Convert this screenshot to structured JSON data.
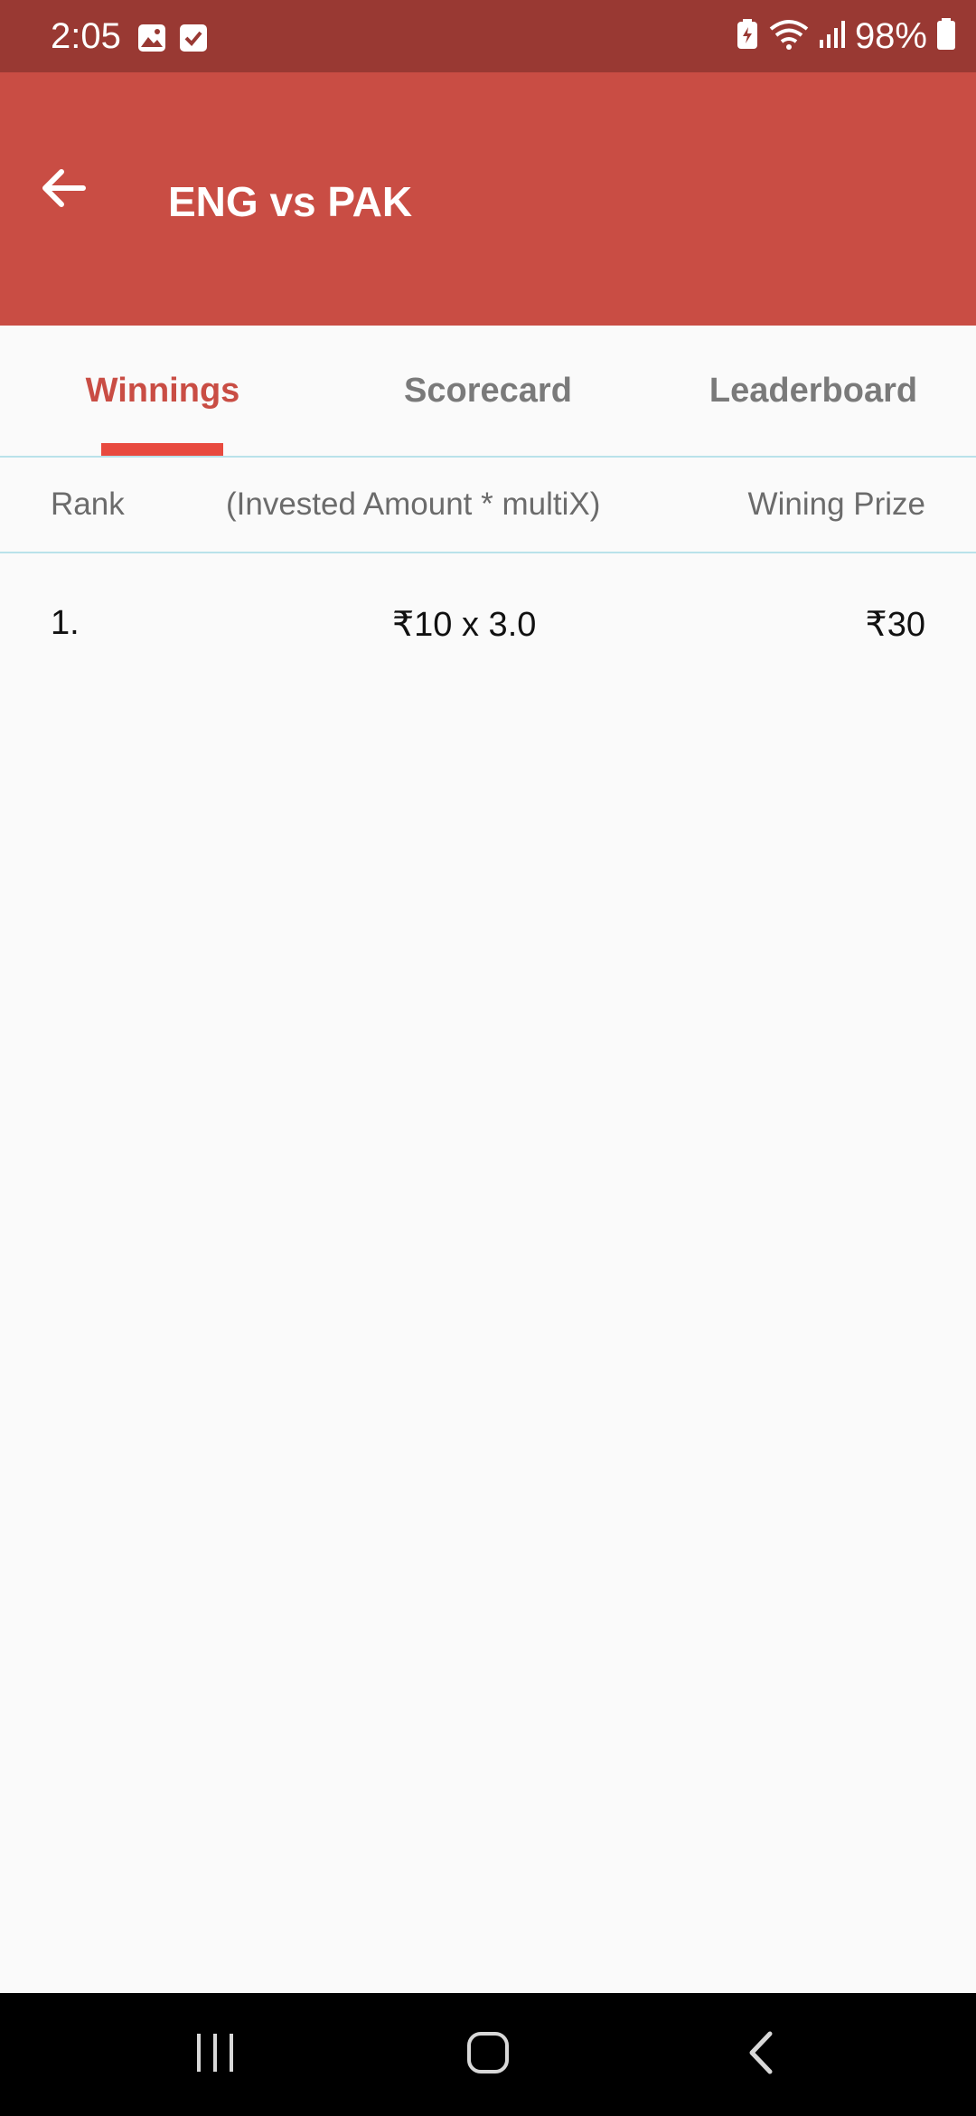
{
  "status_bar": {
    "time": "2:05",
    "battery": "98%",
    "left_icons": [
      "gallery-icon",
      "checkbox-icon"
    ],
    "right_icons": [
      "battery-saver-icon",
      "wifi-icon",
      "signal-icon",
      "battery-icon"
    ]
  },
  "app_bar": {
    "title": "ENG vs PAK",
    "back_icon": "arrow-left-icon",
    "color": "#c94d44"
  },
  "tabs": [
    {
      "label": "Winnings",
      "active": true
    },
    {
      "label": "Scorecard",
      "active": false
    },
    {
      "label": "Leaderboard",
      "active": false
    }
  ],
  "table": {
    "headers": {
      "rank": "Rank",
      "invested": "(Invested Amount * multiX)",
      "prize": "Wining Prize"
    },
    "rows": [
      {
        "rank": "1.",
        "invested": "₹10 x 3.0",
        "prize": "₹30"
      }
    ]
  },
  "nav_bar": {
    "buttons": [
      "recent-apps-icon",
      "home-icon",
      "back-icon"
    ]
  },
  "colors": {
    "accent": "#c94d44",
    "status_bar": "#993933",
    "tab_indicator": "#e84a3f",
    "divider": "#b9e2ea"
  }
}
